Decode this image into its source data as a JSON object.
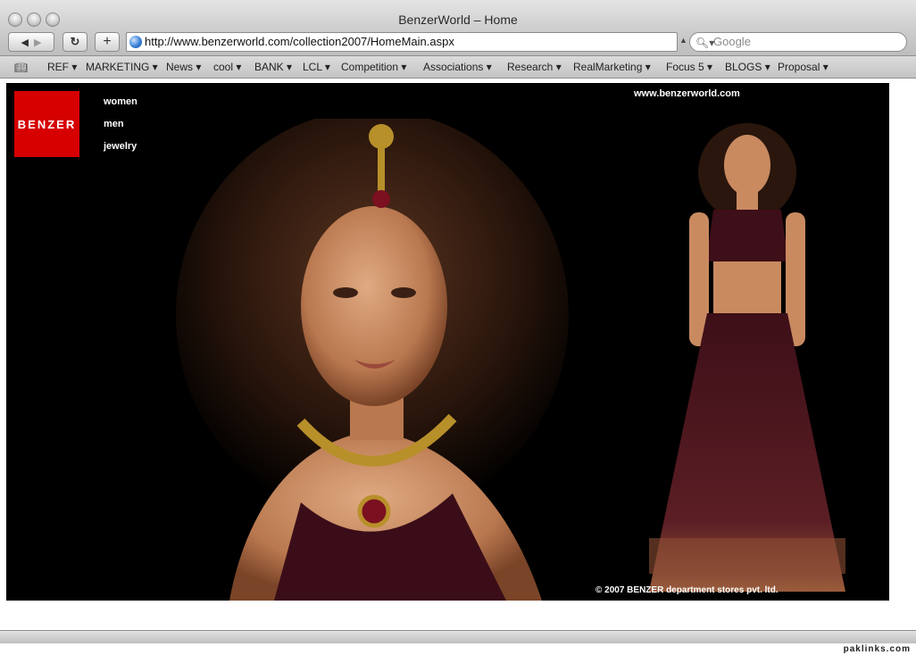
{
  "window": {
    "title": "BenzerWorld – Home"
  },
  "toolbar": {
    "back_icon": "back-arrow-icon",
    "forward_icon": "forward-arrow-icon",
    "reload_icon": "reload-icon",
    "add_icon": "add-bookmark-icon",
    "url": "http://www.benzerworld.com/collection2007/HomeMain.aspx",
    "search_placeholder": "Google"
  },
  "bookmarks": {
    "icon": "bookmarks-book-icon",
    "items": [
      {
        "label": "REF"
      },
      {
        "label": "MARKETING"
      },
      {
        "label": "News"
      },
      {
        "label": "cool"
      },
      {
        "label": "BANK"
      },
      {
        "label": "LCL"
      },
      {
        "label": "Competition"
      },
      {
        "label": "Associations"
      },
      {
        "label": "Research"
      },
      {
        "label": "RealMarketing"
      },
      {
        "label": "Focus 5"
      },
      {
        "label": "BLOGS"
      },
      {
        "label": "Proposal"
      }
    ]
  },
  "page": {
    "logo_text": "BENZER",
    "nav": [
      "women",
      "men",
      "jewelry"
    ],
    "site_url": "www.benzerworld.com",
    "copyright": "© 2007 BENZER department stores pvt. ltd."
  },
  "watermark": "paklinks.com",
  "colors": {
    "brand_red": "#d60000",
    "page_background": "#000000"
  }
}
